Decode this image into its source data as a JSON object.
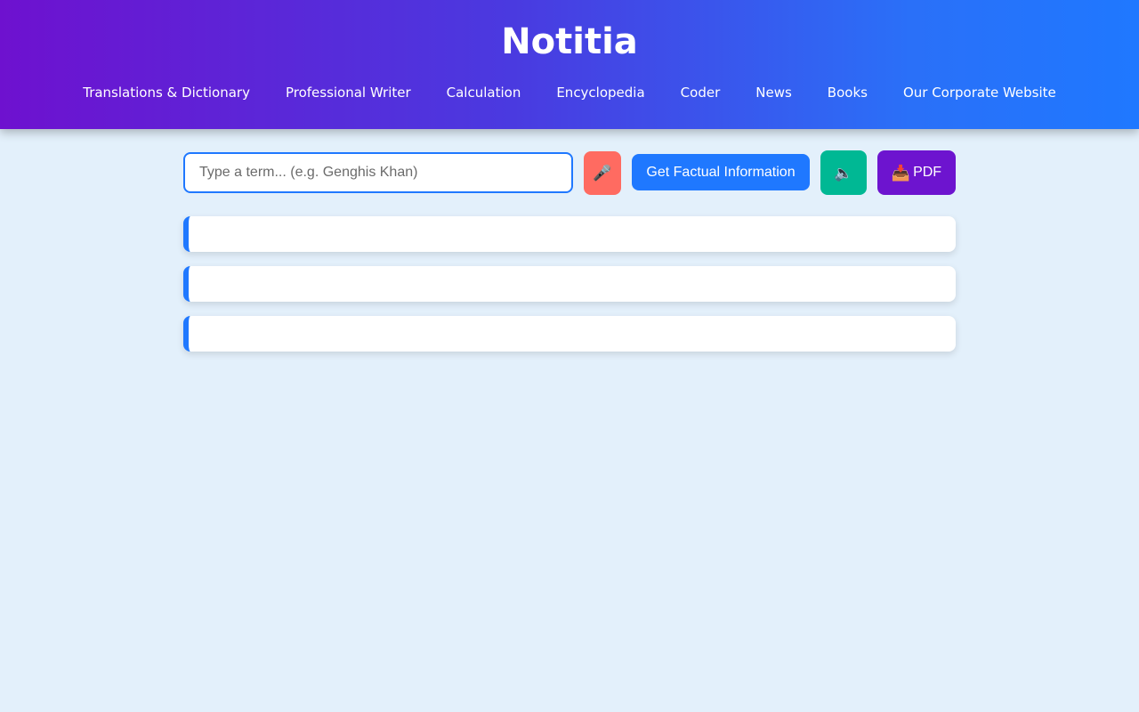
{
  "header": {
    "title": "Notitia",
    "nav": [
      {
        "label": "Translations & Dictionary"
      },
      {
        "label": "Professional Writer"
      },
      {
        "label": "Calculation"
      },
      {
        "label": "Encyclopedia"
      },
      {
        "label": "Coder"
      },
      {
        "label": "News"
      },
      {
        "label": "Books"
      },
      {
        "label": "Our Corporate Website"
      }
    ],
    "gradient_colors": [
      "#6e11cf",
      "#1f78ff"
    ]
  },
  "search": {
    "value": "",
    "placeholder": "Type a term... (e.g. Genghis Khan)"
  },
  "buttons": {
    "mic_icon": "microphone-icon",
    "mic_glyph": "🎤",
    "fact_label": "Get Factual Information",
    "speak_icon": "speaker-icon",
    "speak_glyph": "🔈",
    "pdf_icon": "inbox-tray-icon",
    "pdf_glyph": "📥",
    "pdf_label": "PDF"
  },
  "colors": {
    "background": "#e3f0fb",
    "accent": "#1f78ff",
    "mic": "#ff6b61",
    "speak": "#00b894",
    "pdf": "#6d14cf"
  },
  "results": [
    {
      "text": ""
    },
    {
      "text": ""
    },
    {
      "text": ""
    }
  ]
}
